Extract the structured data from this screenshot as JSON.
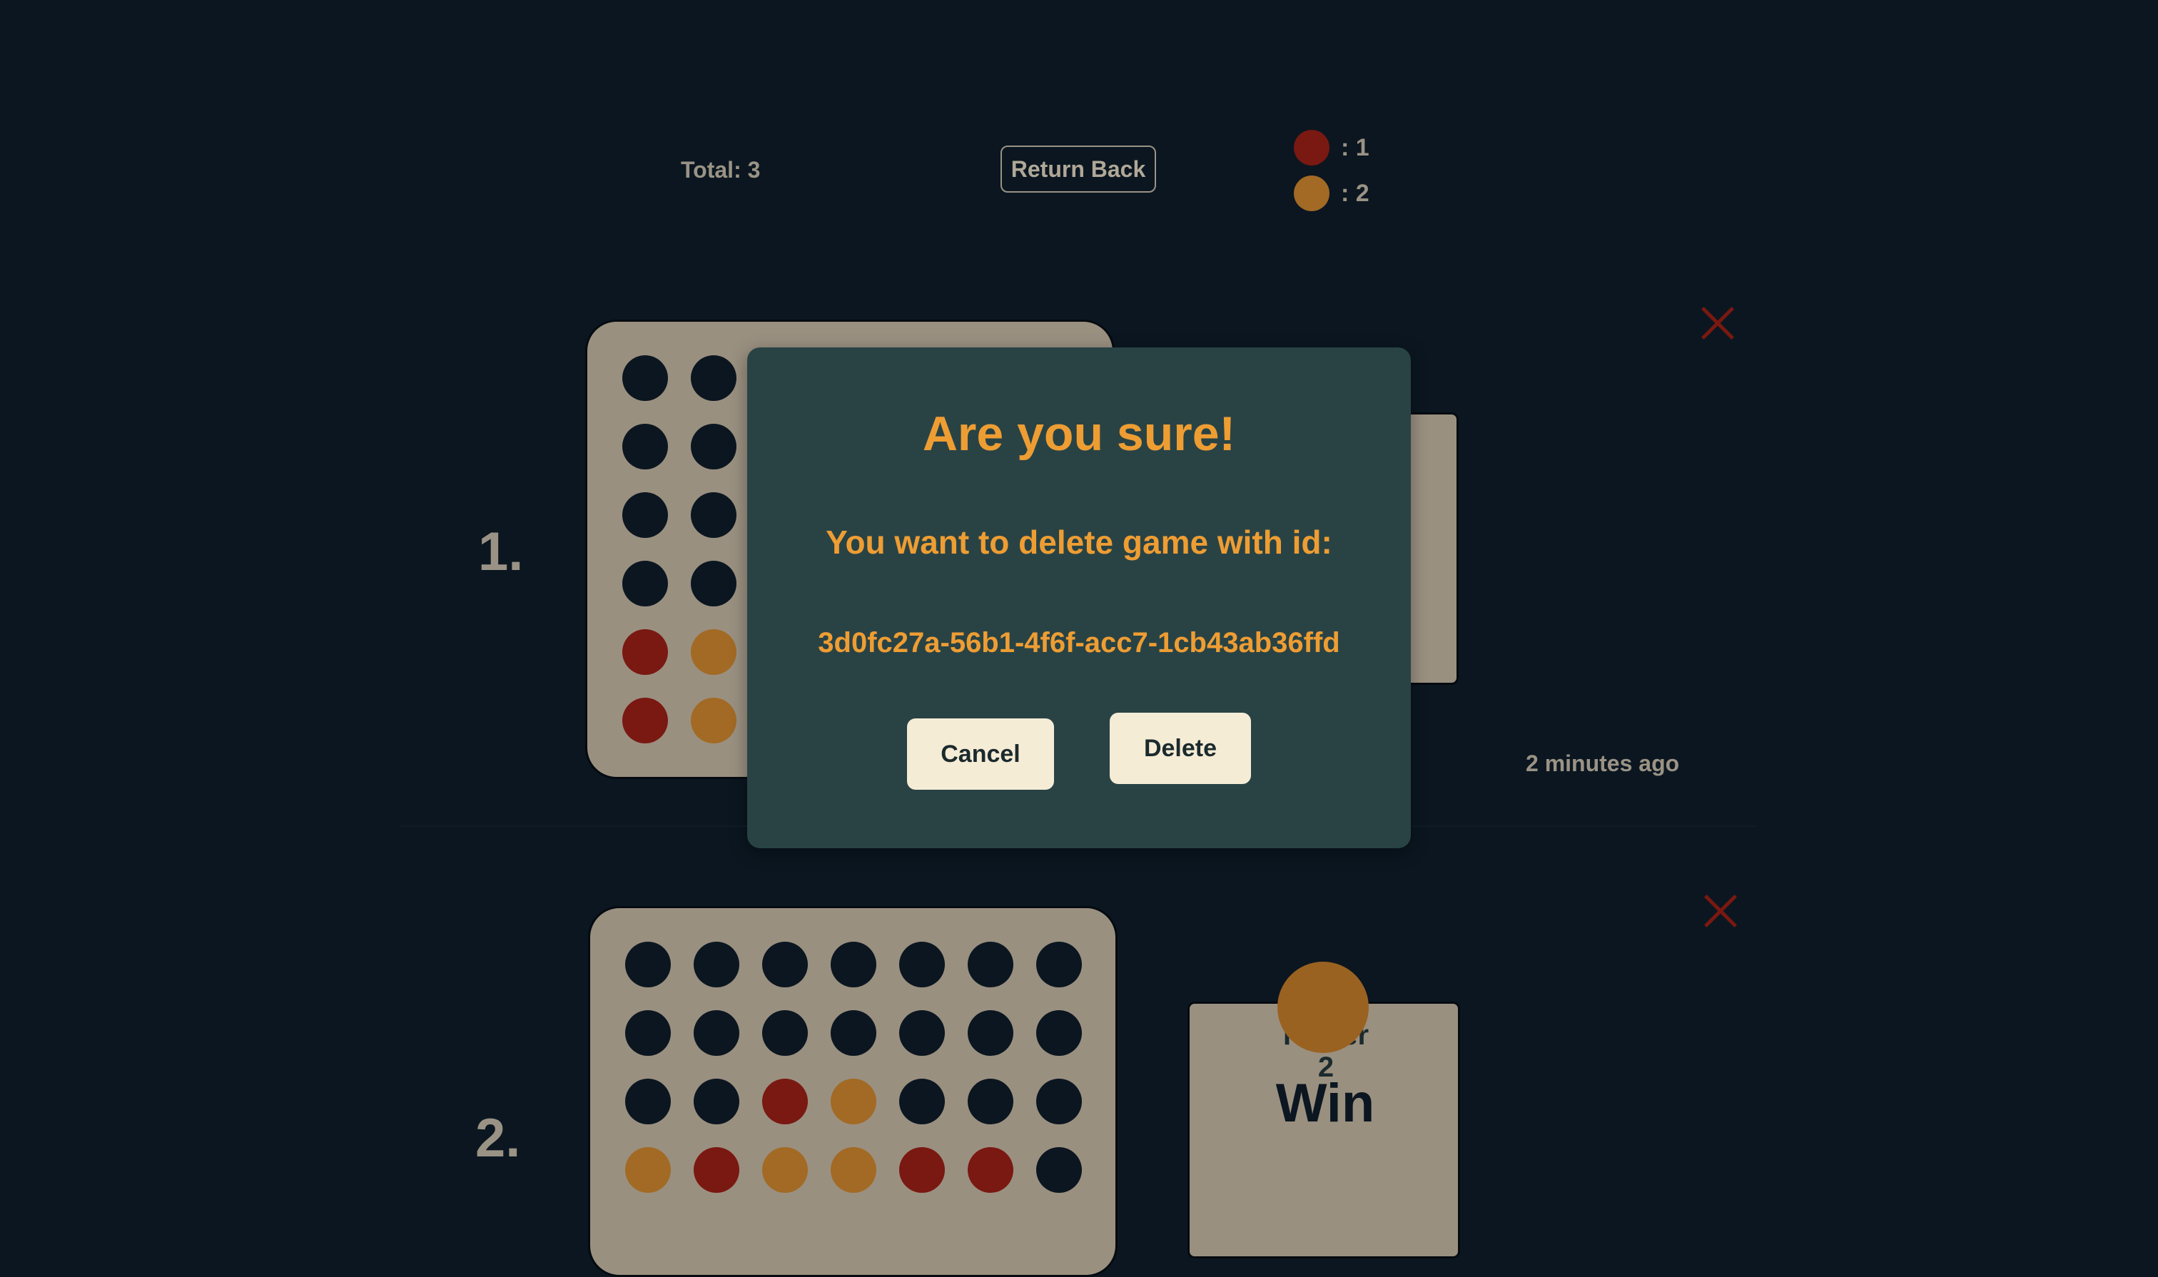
{
  "header": {
    "total_label": "Total: 3",
    "return_label": "Return Back",
    "score": [
      {
        "color": "#7a1812",
        "text": ": 1"
      },
      {
        "color": "#a26a24",
        "text": ": 2"
      }
    ]
  },
  "games": [
    {
      "index": "1.",
      "time_ago": "2 minutes ago"
    },
    {
      "index": "2.",
      "player": "Player 2",
      "result": "Win"
    }
  ],
  "modal": {
    "title": "Are you sure!",
    "message": "You want to delete game with id:",
    "game_id": "3d0fc27a-56b1-4f6f-acc7-1cb43ab36ffd",
    "cancel_label": "Cancel",
    "delete_label": "Delete"
  },
  "colors": {
    "empty": "#0b1620",
    "red": "#7a1812",
    "yellow": "#a26a24",
    "accent": "#ee9d33"
  }
}
